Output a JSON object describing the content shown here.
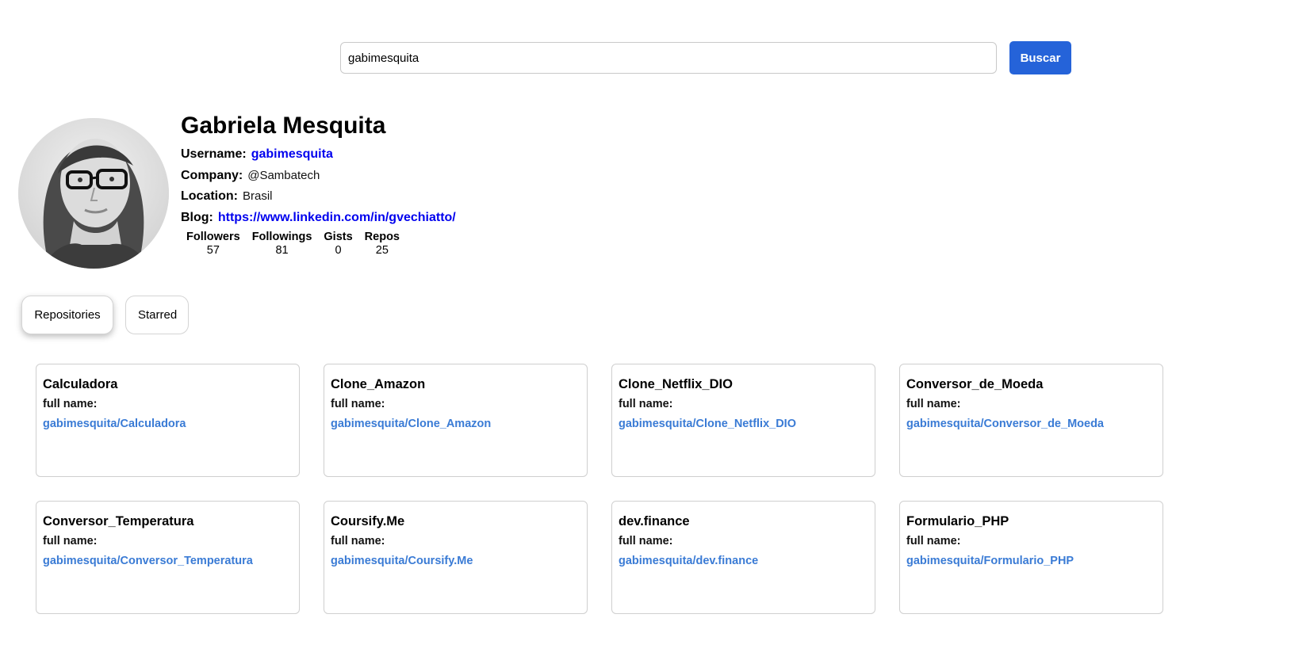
{
  "search": {
    "value": "gabimesquita",
    "button_label": "Buscar"
  },
  "profile": {
    "name": "Gabriela Mesquita",
    "username_label": "Username:",
    "username": "gabimesquita",
    "company_label": "Company:",
    "company": "@Sambatech",
    "location_label": "Location:",
    "location": "Brasil",
    "blog_label": "Blog:",
    "blog": "https://www.linkedin.com/in/gvechiatto/",
    "stats": [
      {
        "label": "Followers",
        "value": "57"
      },
      {
        "label": "Followings",
        "value": "81"
      },
      {
        "label": "Gists",
        "value": "0"
      },
      {
        "label": "Repos",
        "value": "25"
      }
    ]
  },
  "tabs": [
    {
      "label": "Repositories",
      "active": true
    },
    {
      "label": "Starred",
      "active": false
    }
  ],
  "repos": [
    {
      "name": "Calculadora",
      "full_name_label": "full name:",
      "full_name": "gabimesquita/Calculadora"
    },
    {
      "name": "Clone_Amazon",
      "full_name_label": "full name:",
      "full_name": "gabimesquita/Clone_Amazon"
    },
    {
      "name": "Clone_Netflix_DIO",
      "full_name_label": "full name:",
      "full_name": "gabimesquita/Clone_Netflix_DIO"
    },
    {
      "name": "Conversor_de_Moeda",
      "full_name_label": "full name:",
      "full_name": "gabimesquita/Conversor_de_Moeda"
    },
    {
      "name": "Conversor_Temperatura",
      "full_name_label": "full name:",
      "full_name": "gabimesquita/Conversor_Temperatura"
    },
    {
      "name": "Coursify.Me",
      "full_name_label": "full name:",
      "full_name": "gabimesquita/Coursify.Me"
    },
    {
      "name": "dev.finance",
      "full_name_label": "full name:",
      "full_name": "gabimesquita/dev.finance"
    },
    {
      "name": "Formulario_PHP",
      "full_name_label": "full name:",
      "full_name": "gabimesquita/Formulario_PHP"
    }
  ],
  "colors": {
    "accent_button": "#2563d9",
    "link": "#0000ee",
    "repo_link": "#3a7bd5"
  }
}
